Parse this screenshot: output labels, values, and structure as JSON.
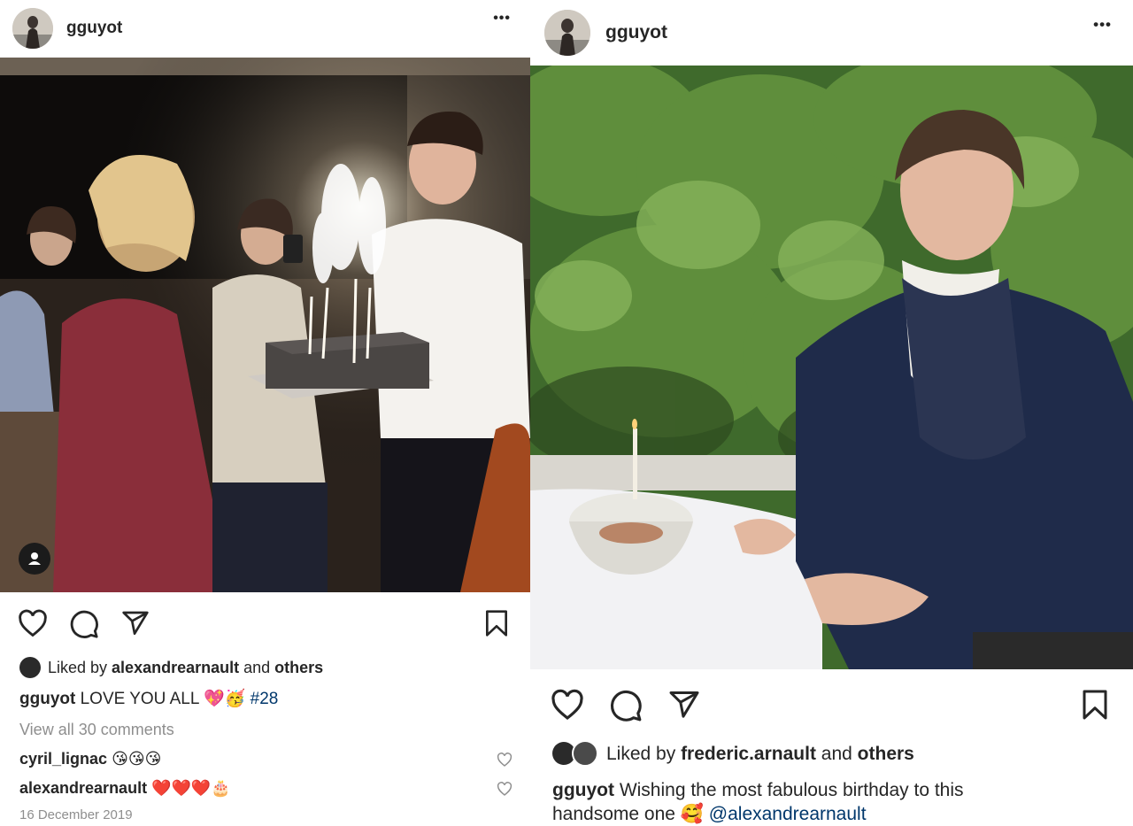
{
  "left_post": {
    "username": "gguyot",
    "menu_label": "•••",
    "liked_by_prefix": "Liked by ",
    "liked_by_user": "alexandrearnault",
    "liked_by_and": " and ",
    "liked_by_others": "others",
    "caption_user": "gguyot",
    "caption_text": " LOVE YOU ALL ",
    "hashtag": "#28",
    "view_comments": "View all 30 comments",
    "comments": [
      {
        "user": "cyril_lignac",
        "emojis": "😘😘😘"
      },
      {
        "user": "alexandrearnault",
        "emojis": "❤️❤️❤️🎂"
      }
    ],
    "date": "16 December 2019",
    "caption_emojis": "💖🥳"
  },
  "right_post": {
    "username": "gguyot",
    "menu_label": "•••",
    "liked_by_prefix": "Liked by ",
    "liked_by_user": "frederic.arnault",
    "liked_by_and": " and ",
    "liked_by_others": "others",
    "caption_user": "gguyot",
    "caption_line1": " Wishing the most fabulous birthday to this",
    "caption_line2": "handsome one ",
    "caption_emoji": "🥰",
    "mention": "@alexandrearnault"
  },
  "icons": {
    "like": "heart-icon",
    "comment": "comment-icon",
    "share": "send-icon",
    "save": "bookmark-icon",
    "user_tag": "user-tag-icon"
  },
  "colors": {
    "text": "#262626",
    "muted": "#8e8e8e",
    "link": "#00376b"
  }
}
